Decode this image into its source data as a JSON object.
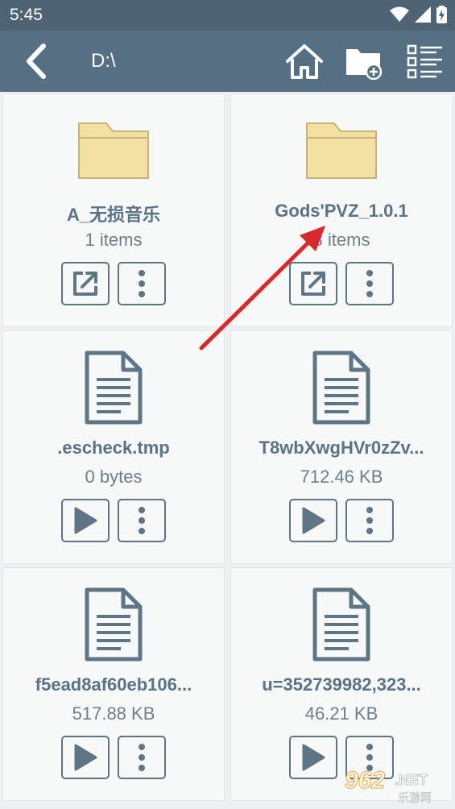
{
  "status_bar": {
    "time": "5:45"
  },
  "app_bar": {
    "path": "D:\\"
  },
  "items": [
    {
      "name": "A_无损音乐",
      "detail": "1 items",
      "type": "folder"
    },
    {
      "name": "Gods'PVZ_1.0.1",
      "detail": "8 items",
      "type": "folder"
    },
    {
      "name": ".escheck.tmp",
      "detail": "0 bytes",
      "type": "file"
    },
    {
      "name": "T8wbXwgHVr0zZv...",
      "detail": "712.46 KB",
      "type": "file"
    },
    {
      "name": "f5ead8af60eb106...",
      "detail": "517.88 KB",
      "type": "file"
    },
    {
      "name": "u=352739982,323...",
      "detail": "46.21 KB",
      "type": "file"
    }
  ],
  "colors": {
    "app_bar": "#566f82",
    "status_bar": "#4e6475",
    "folder": "#f3e1a3",
    "accent_text": "#5a7384",
    "annotation_arrow": "#d9272b"
  },
  "watermark": {
    "text": "962",
    "suffix": ".NET",
    "sub": "乐游网"
  }
}
